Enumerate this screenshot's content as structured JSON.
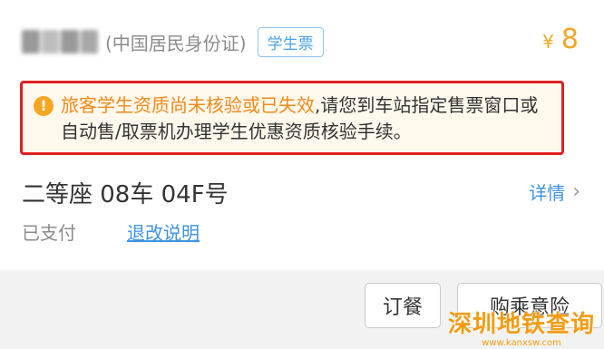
{
  "ticket": {
    "id_type": "(中国居民身份证)",
    "badge": "学生票",
    "currency": "¥",
    "price": "8"
  },
  "warning": {
    "icon": "!",
    "highlight": "旅客学生资质尚未核验或已失效",
    "text": ",请您到车站指定售票窗口或自动售/取票机办理学生优惠资质核验手续。"
  },
  "seat": {
    "info": "二等座  08车  04F号",
    "details_label": "详情",
    "chevron": "›"
  },
  "status": {
    "paid": "已支付",
    "refund_link": "退改说明"
  },
  "actions": {
    "meal": "订餐",
    "insurance": "购乘意险"
  },
  "watermark": {
    "logo": "深圳地铁查询",
    "url": "www.kanxsw.com"
  },
  "colors": {
    "accent_orange": "#f5a623",
    "link_blue": "#3f93e0",
    "alert_red": "#e02020"
  }
}
